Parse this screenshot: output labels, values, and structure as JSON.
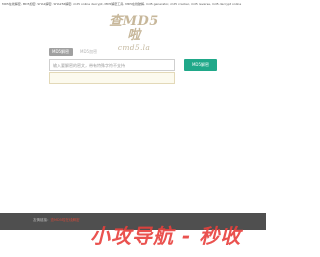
{
  "top_banner": {
    "text": "MD5在线解密, MD5加密, SHA1解密, SHA256解密, md5 online decrypt, MD5解密工具, MD5在线破解, md5 generator, md5 cracker, md5 reverse, md5 decrypt online"
  },
  "logo": {
    "title": "查MD5啦",
    "domain": "cmd5.la"
  },
  "tabs": [
    {
      "label": "MD5解密",
      "active": true
    },
    {
      "label": "MD5加密",
      "active": false
    }
  ],
  "search": {
    "placeholder": "输入要解密的密文，带有特殊字符不支持",
    "value": ""
  },
  "decrypt_button": {
    "label": "MD5解密"
  },
  "result": {
    "text": ""
  },
  "footer": {
    "prefix": "友情链接：",
    "link": "查MD5啦在线解密"
  },
  "watermark": {
    "text": "小攻导航 - 秒收"
  },
  "colors": {
    "accent": "#20a889",
    "footer_bg": "#4f4f4f",
    "watermark": "#e8403c",
    "logo": "#c7b79a"
  }
}
